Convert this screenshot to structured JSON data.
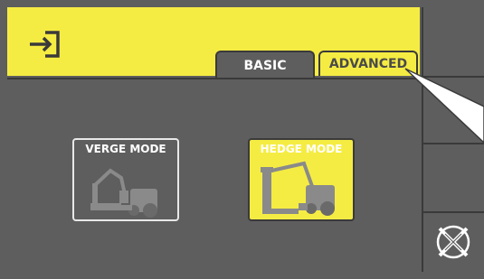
{
  "header": {
    "exit_icon": "exit-arrow-icon"
  },
  "tabs": [
    {
      "label": "BASIC",
      "active": true
    },
    {
      "label": "ADVANCED",
      "active": false
    }
  ],
  "modes": [
    {
      "label": "VERGE MODE",
      "selected": false,
      "icon": "verge-mower-icon"
    },
    {
      "label": "HEDGE MODE",
      "selected": true,
      "icon": "hedge-cutter-icon"
    }
  ],
  "sidebar": {
    "buttons": [
      {
        "icon": ""
      },
      {
        "icon": ""
      },
      {
        "icon": ""
      },
      {
        "icon": "cancel-x-icon"
      }
    ]
  },
  "colors": {
    "accent_yellow": "#f5ec43",
    "panel_gray": "#5e5e5e",
    "border_dark": "#3a3a3a",
    "text_white": "#ffffff"
  }
}
